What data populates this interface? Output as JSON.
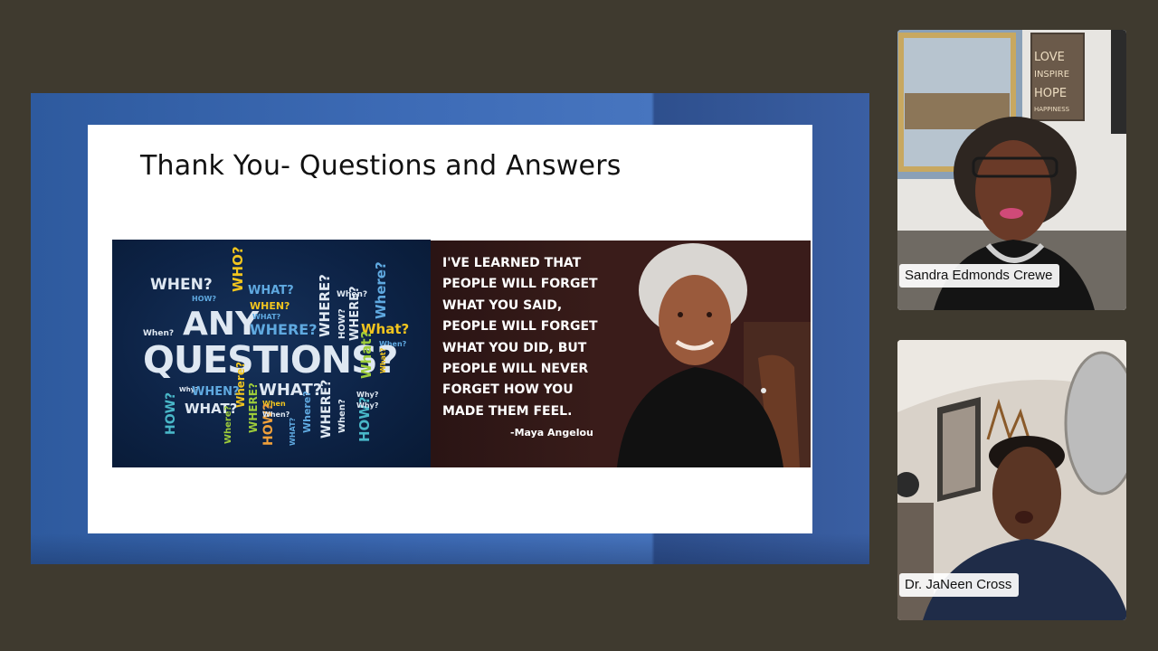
{
  "slide": {
    "title": "Thank You- Questions and Answers",
    "word_cloud": {
      "words": [
        "WHEN?",
        "HOW?",
        "WHO?",
        "WHAT?",
        "WHEN?",
        "When?",
        "Where?",
        "ANY",
        "WHAT?",
        "WHERE?",
        "WHERE?",
        "HOW?",
        "When?",
        "WHERE?",
        "What?",
        "When?",
        "QUESTIONS?",
        "What?",
        "What?",
        "Why?",
        "WHEN?",
        "WHAT?",
        "Where?",
        "WHERE?",
        "When",
        "HOW?",
        "HOW?",
        "When?",
        "WHAT?",
        "Where?",
        "WHERE?",
        "Why?",
        "HOW?",
        "Why?",
        "WHAT?",
        "When?",
        "Where?"
      ]
    },
    "quote": {
      "text": "I'VE LEARNED THAT\nPEOPLE WILL FORGET\nWHAT YOU SAID,\nPEOPLE WILL FORGET\nWHAT YOU DID, BUT\nPEOPLE WILL NEVER\nFORGET HOW YOU\nMADE THEM FEEL.",
      "author": "-Maya Angelou"
    }
  },
  "participants": [
    {
      "name": "Sandra Edmonds Crewe",
      "poster_words": [
        "LOVE",
        "INSPIRE",
        "HOPE",
        "HAPPINESS"
      ]
    },
    {
      "name": "Dr. JaNeen Cross"
    }
  ],
  "colors": {
    "app_background": "#3f3a2f",
    "share_border_blue": "#3d6bb6",
    "slide_background": "#ffffff",
    "word_cloud_background": "#0d2346"
  }
}
